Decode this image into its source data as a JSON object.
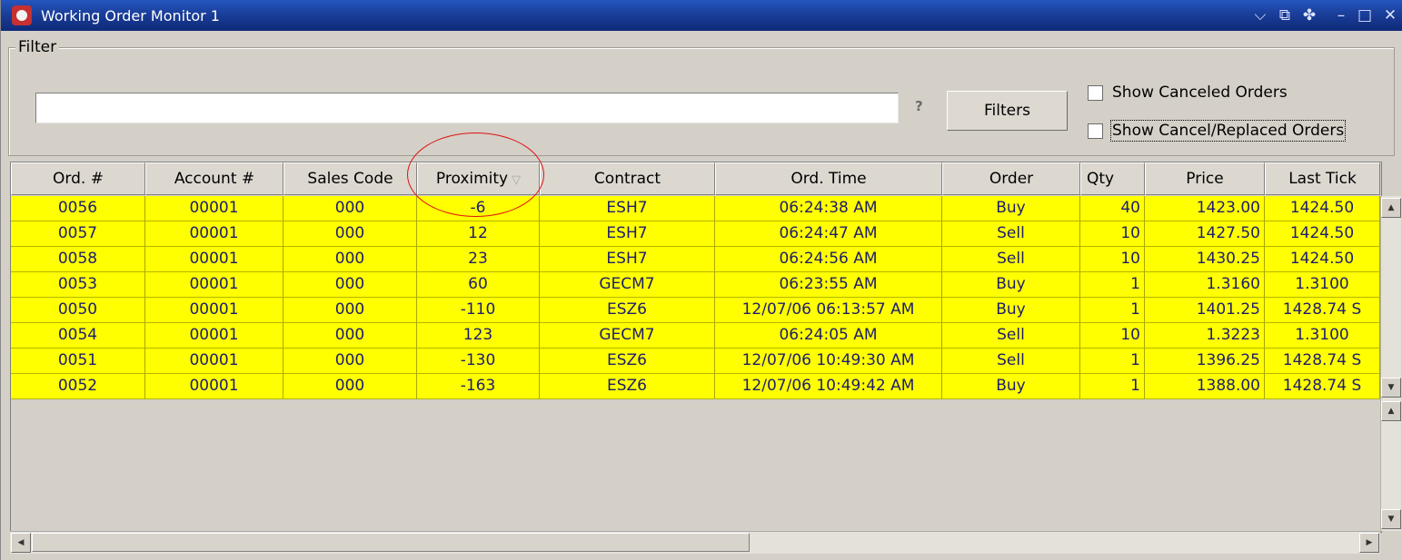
{
  "window": {
    "title": "Working Order Monitor 1",
    "controls": [
      "⌵",
      "⧉",
      "✤",
      "–",
      "□",
      "✕"
    ]
  },
  "filter": {
    "legend": "Filter",
    "input_value": "",
    "help": "?",
    "button_label": "Filters",
    "show_canceled_label": "Show Canceled Orders",
    "show_canceled_checked": false,
    "show_cancel_replaced_label": "Show Cancel/Replaced Orders",
    "show_cancel_replaced_checked": false
  },
  "table": {
    "columns": [
      "Ord. #",
      "Account #",
      "Sales Code",
      "Proximity",
      "Contract",
      "Ord. Time",
      "Order",
      "Qty",
      "Price",
      "Last Tick"
    ],
    "sorted_column": "Proximity",
    "row_color": "#ffff00",
    "rows": [
      [
        "0056",
        "00001",
        "000",
        "-6",
        "ESH7",
        "06:24:38 AM",
        "Buy",
        "40",
        "1423.00",
        "1424.50"
      ],
      [
        "0057",
        "00001",
        "000",
        "12",
        "ESH7",
        "06:24:47 AM",
        "Sell",
        "10",
        "1427.50",
        "1424.50"
      ],
      [
        "0058",
        "00001",
        "000",
        "23",
        "ESH7",
        "06:24:56 AM",
        "Sell",
        "10",
        "1430.25",
        "1424.50"
      ],
      [
        "0053",
        "00001",
        "000",
        "60",
        "GECM7",
        "06:23:55 AM",
        "Buy",
        "1",
        "1.3160",
        "1.3100"
      ],
      [
        "0050",
        "00001",
        "000",
        "-110",
        "ESZ6",
        "12/07/06 06:13:57 AM",
        "Buy",
        "1",
        "1401.25",
        "1428.74 S"
      ],
      [
        "0054",
        "00001",
        "000",
        "123",
        "GECM7",
        "06:24:05 AM",
        "Sell",
        "10",
        "1.3223",
        "1.3100"
      ],
      [
        "0051",
        "00001",
        "000",
        "-130",
        "ESZ6",
        "12/07/06 10:49:30 AM",
        "Sell",
        "1",
        "1396.25",
        "1428.74 S"
      ],
      [
        "0052",
        "00001",
        "000",
        "-163",
        "ESZ6",
        "12/07/06 10:49:42 AM",
        "Buy",
        "1",
        "1388.00",
        "1428.74 S"
      ]
    ]
  }
}
